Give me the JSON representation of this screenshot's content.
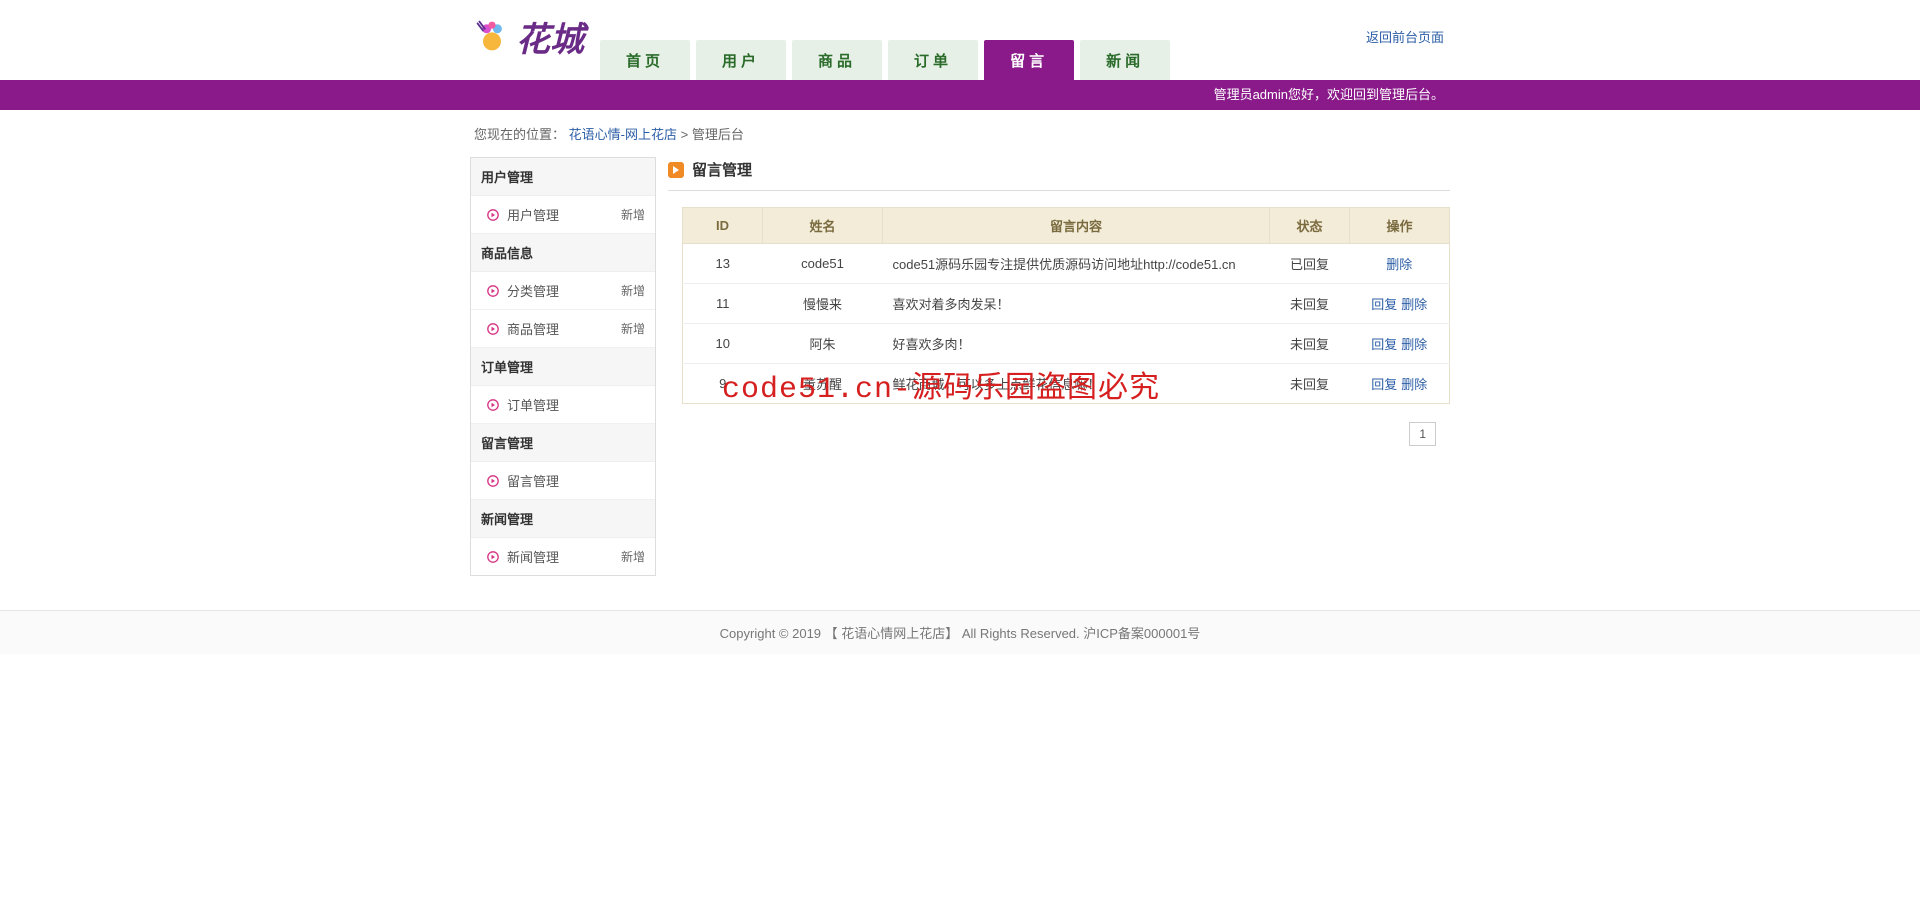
{
  "top_link": "返回前台页面",
  "logo_text": "花城",
  "nav": [
    {
      "label": "首页",
      "active": false
    },
    {
      "label": "用户",
      "active": false
    },
    {
      "label": "商品",
      "active": false
    },
    {
      "label": "订单",
      "active": false
    },
    {
      "label": "留言",
      "active": true
    },
    {
      "label": "新闻",
      "active": false
    }
  ],
  "welcome": "管理员admin您好，欢迎回到管理后台。",
  "breadcrumb": {
    "prefix": "您现在的位置：",
    "link": "花语心情-网上花店",
    "sep": " > ",
    "current": "管理后台"
  },
  "sidebar": {
    "groups": [
      {
        "title": "用户管理",
        "items": [
          {
            "label": "用户管理",
            "add": "新增"
          }
        ]
      },
      {
        "title": "商品信息",
        "items": [
          {
            "label": "分类管理",
            "add": "新增"
          },
          {
            "label": "商品管理",
            "add": "新增"
          }
        ]
      },
      {
        "title": "订单管理",
        "items": [
          {
            "label": "订单管理",
            "add": ""
          }
        ]
      },
      {
        "title": "留言管理",
        "items": [
          {
            "label": "留言管理",
            "add": ""
          }
        ]
      },
      {
        "title": "新闻管理",
        "items": [
          {
            "label": "新闻管理",
            "add": "新增"
          }
        ]
      }
    ]
  },
  "panel_title": "留言管理",
  "table": {
    "headers": {
      "id": "ID",
      "name": "姓名",
      "content": "留言内容",
      "status": "状态",
      "ops": "操作"
    },
    "ops_labels": {
      "reply": "回复",
      "delete": "删除"
    },
    "rows": [
      {
        "id": "13",
        "name": "code51",
        "content": "code51源码乐园专注提供优质源码访问地址http://code51.cn",
        "status": "已回复",
        "ops": [
          "delete"
        ]
      },
      {
        "id": "11",
        "name": "慢慢来",
        "content": "喜欢对着多肉发呆！",
        "status": "未回复",
        "ops": [
          "reply",
          "delete"
        ]
      },
      {
        "id": "10",
        "name": "阿朱",
        "content": "好喜欢多肉！",
        "status": "未回复",
        "ops": [
          "reply",
          "delete"
        ]
      },
      {
        "id": "9",
        "name": "董苏醒",
        "content": "鲜花商城，可以多上点鲜花信息嘛！",
        "status": "未回复",
        "ops": [
          "reply",
          "delete"
        ]
      }
    ]
  },
  "pagination": {
    "pages": [
      "1"
    ]
  },
  "watermark": "code51.cn-源码乐园盗图必究",
  "footer": "Copyright © 2019 【 花语心情网上花店】 All Rights Reserved. 沪ICP备案000001号"
}
